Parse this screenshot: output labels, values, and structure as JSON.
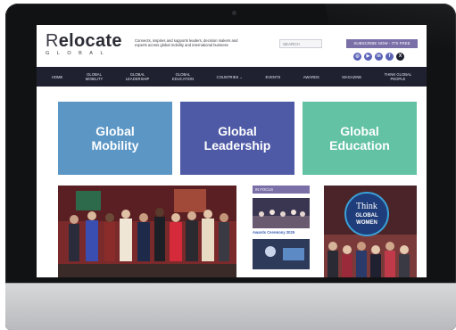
{
  "site": {
    "logo_main_r": "R",
    "logo_main_rest": "elocate",
    "logo_sub": "GLOBAL",
    "tagline": "Connects, inspires and supports leaders, decision makers and experts across global mobility and international business",
    "search_placeholder": "SEARCH",
    "subscribe_label": "SUBSCRIBE NOW - IT'S FREE",
    "socials": [
      {
        "icon": "instagram-icon",
        "glyph": "◎",
        "color": "#5b63b8"
      },
      {
        "icon": "youtube-icon",
        "glyph": "▶",
        "color": "#5b63b8"
      },
      {
        "icon": "linkedin-icon",
        "glyph": "in",
        "color": "#5b63b8"
      },
      {
        "icon": "facebook-icon",
        "glyph": "f",
        "color": "#5b63b8"
      },
      {
        "icon": "x-icon",
        "glyph": "X",
        "color": "#1f2030"
      }
    ]
  },
  "nav": {
    "items": [
      "HOME",
      "GLOBAL\nMOBILITY",
      "GLOBAL\nLEADERSHIP",
      "GLOBAL\nEDUCATION",
      "COUNTRIES ⌄",
      "EVENTS",
      "AWARDS",
      "MAGAZINE",
      "THINK GLOBAL\nPEOPLE"
    ]
  },
  "tiles": [
    {
      "label": "Global\nMobility",
      "color": "#5b96c5"
    },
    {
      "label": "Global\nLeadership",
      "color": "#4e5aa6"
    },
    {
      "label": "Global\nEducation",
      "color": "#62c2a3"
    }
  ],
  "in_focus": {
    "label": "IN FOCUS",
    "awards_caption": "Awards Ceremony 2025"
  },
  "think_badge": {
    "line1": "Think",
    "line2": "GLOBAL",
    "line3": "WOMEN"
  }
}
